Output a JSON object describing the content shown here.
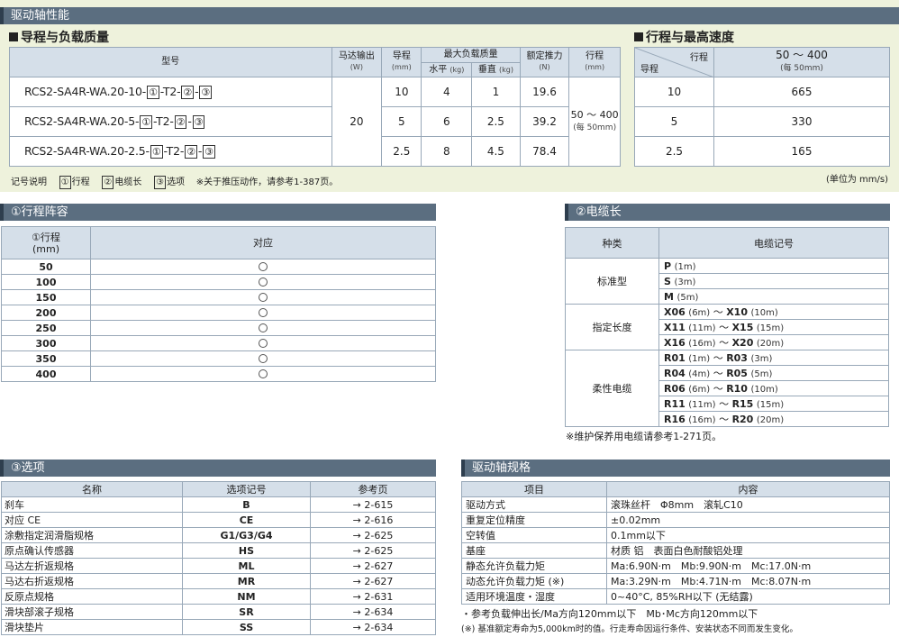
{
  "header": {
    "title": "驱动轴性能"
  },
  "spec": {
    "title": "导程与负载质量",
    "headers": {
      "model": "型号",
      "motor": "马达输出",
      "motor_unit": "(W)",
      "lead": "导程",
      "lead_unit": "(mm)",
      "max_load": "最大负载质量",
      "horizontal": "水平",
      "vertical": "垂直",
      "kg": "(kg)",
      "thrust": "额定推力",
      "thrust_unit": "(N)",
      "stroke": "行程",
      "stroke_unit": "(mm)"
    },
    "rows": [
      {
        "model_prefix": "RCS2-SA4R-WA.20-10-",
        "lead": "10",
        "horizontal": "4",
        "vertical": "1",
        "thrust": "19.6"
      },
      {
        "model_prefix": "RCS2-SA4R-WA.20-5-",
        "lead": "5",
        "horizontal": "6",
        "vertical": "2.5",
        "thrust": "39.2"
      },
      {
        "model_prefix": "RCS2-SA4R-WA.20-2.5-",
        "lead": "2.5",
        "horizontal": "8",
        "vertical": "4.5",
        "thrust": "78.4"
      }
    ],
    "motor_value": "20",
    "stroke_range": "50 ～ 400",
    "stroke_step": "(每 50mm)",
    "sym1": "①",
    "sym2": "②",
    "sym3": "③",
    "dash": "-",
    "t2": "-T2-"
  },
  "speed": {
    "title": "行程与最高速度",
    "corner_stroke": "行程",
    "corner_lead": "导程",
    "range": "50 ～ 400",
    "range_step": "(每 50mm)",
    "rows": [
      {
        "lead": "10",
        "speed": "665"
      },
      {
        "lead": "5",
        "speed": "330"
      },
      {
        "lead": "2.5",
        "speed": "165"
      }
    ],
    "unit": "(单位为 mm/s)"
  },
  "legend": {
    "label": "记号说明",
    "s1": "①",
    "t1": "行程",
    "s2": "②",
    "t2": "电缆长",
    "s3": "③",
    "t3": "选项",
    "note": "※关于推压动作，请参考1-387页。"
  },
  "stroke_section": {
    "title": "①行程阵容",
    "col1_line1": "①行程",
    "col1_line2": "(mm)",
    "col2": "对应",
    "values": [
      "50",
      "100",
      "150",
      "200",
      "250",
      "300",
      "350",
      "400"
    ]
  },
  "cable_section": {
    "title": "②电缆长",
    "col1": "种类",
    "col2": "电缆记号",
    "groups": [
      {
        "kind": "标准型",
        "items": [
          {
            "a": "P",
            "al": "(1m)",
            "b": "",
            "bl": ""
          },
          {
            "a": "S",
            "al": "(3m)",
            "b": "",
            "bl": ""
          },
          {
            "a": "M",
            "al": "(5m)",
            "b": "",
            "bl": ""
          }
        ]
      },
      {
        "kind": "指定长度",
        "items": [
          {
            "a": "X06",
            "al": "(6m)",
            "b": "X10",
            "bl": "(10m)"
          },
          {
            "a": "X11",
            "al": "(11m)",
            "b": "X15",
            "bl": "(15m)"
          },
          {
            "a": "X16",
            "al": "(16m)",
            "b": "X20",
            "bl": "(20m)"
          }
        ]
      },
      {
        "kind": "柔性电缆",
        "items": [
          {
            "a": "R01",
            "al": "(1m)",
            "b": "R03",
            "bl": "(3m)"
          },
          {
            "a": "R04",
            "al": "(4m)",
            "b": "R05",
            "bl": "(5m)"
          },
          {
            "a": "R06",
            "al": "(6m)",
            "b": "R10",
            "bl": "(10m)"
          },
          {
            "a": "R11",
            "al": "(11m)",
            "b": "R15",
            "bl": "(15m)"
          },
          {
            "a": "R16",
            "al": "(16m)",
            "b": "R20",
            "bl": "(20m)"
          }
        ]
      }
    ],
    "tilde": "～",
    "note": "※维护保养用电缆请参考1-271页。"
  },
  "options_section": {
    "title": "③选项",
    "col1": "名称",
    "col2": "选项记号",
    "col3": "参考页",
    "rows": [
      {
        "name": "刹车",
        "code": "B",
        "page": "→ 2-615"
      },
      {
        "name": "对应 CE",
        "code": "CE",
        "page": "→ 2-616"
      },
      {
        "name": "涂敷指定润滑脂规格",
        "code": "G1/G3/G4",
        "page": "→ 2-625"
      },
      {
        "name": "原点确认传感器",
        "code": "HS",
        "page": "→ 2-625"
      },
      {
        "name": "马达左折返规格",
        "code": "ML",
        "page": "→ 2-627"
      },
      {
        "name": "马达右折返规格",
        "code": "MR",
        "page": "→ 2-627"
      },
      {
        "name": "反原点规格",
        "code": "NM",
        "page": "→ 2-631"
      },
      {
        "name": "滑块部滚子规格",
        "code": "SR",
        "page": "→ 2-634"
      },
      {
        "name": "滑块垫片",
        "code": "SS",
        "page": "→ 2-634"
      }
    ]
  },
  "drive_section": {
    "title": "驱动轴规格",
    "col1": "项目",
    "col2": "内容",
    "rows": [
      {
        "item": "驱动方式",
        "value": "滚珠丝杆　Φ8mm　滚轧C10"
      },
      {
        "item": "重复定位精度",
        "value": "±0.02mm"
      },
      {
        "item": "空转值",
        "value": "0.1mm以下"
      },
      {
        "item": "基座",
        "value": "材质 铝　表面白色耐酸铝处理"
      },
      {
        "item": "静态允许负载力矩",
        "value": "Ma:6.90N·m　Mb:9.90N·m　Mc:17.0N·m"
      },
      {
        "item": "动态允许负载力矩 (※)",
        "value": "Ma:3.29N·m　Mb:4.71N·m　Mc:8.07N·m"
      },
      {
        "item": "适用环境温度・湿度",
        "value": "0~40°C, 85%RH以下 (无结露)"
      }
    ],
    "note1": "・参考负载伸出长/Ma方向120mm以下　Mb･Mc方向120mm以下",
    "note2": "(※) 基准额定寿命为5,000km时的值。行走寿命因运行条件、安装状态不同而发生变化。"
  }
}
